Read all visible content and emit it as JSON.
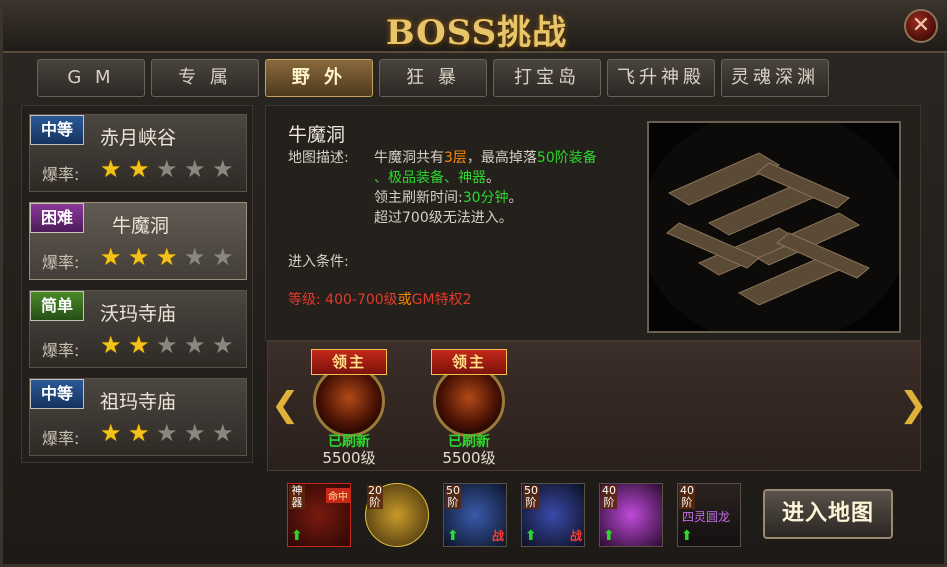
{
  "window": {
    "title": "BOSS挑战",
    "close_icon": "close-icon"
  },
  "tabs": [
    {
      "label": "G M",
      "active": false
    },
    {
      "label": "专 属",
      "active": false
    },
    {
      "label": "野 外",
      "active": true
    },
    {
      "label": "狂 暴",
      "active": false
    },
    {
      "label": "打宝岛",
      "active": false
    },
    {
      "label": "飞升神殿",
      "active": false
    },
    {
      "label": "灵魂深渊",
      "active": false
    }
  ],
  "maps": [
    {
      "difficulty": "中等",
      "name": "赤月峡谷",
      "rate_label": "爆率:",
      "stars": 2,
      "max_stars": 5,
      "selected": false
    },
    {
      "difficulty": "困难",
      "name": "牛魔洞",
      "rate_label": "爆率:",
      "stars": 3,
      "max_stars": 5,
      "selected": true
    },
    {
      "difficulty": "简单",
      "name": "沃玛寺庙",
      "rate_label": "爆率:",
      "stars": 2,
      "max_stars": 5,
      "selected": false
    },
    {
      "difficulty": "中等",
      "name": "祖玛寺庙",
      "rate_label": "爆率:",
      "stars": 2,
      "max_stars": 5,
      "selected": false
    }
  ],
  "detail": {
    "name": "牛魔洞",
    "desc_label": "地图描述:",
    "desc_line1_a": "牛魔洞共有",
    "desc_line1_b": "3层",
    "desc_line1_c": "，最高掉落",
    "desc_line1_d": "50阶装备",
    "desc_line2": "、极品装备、神器",
    "desc_line2_end": "。",
    "desc_line3_a": "领主刷新时间:",
    "desc_line3_b": "30分钟",
    "desc_line3_c": "。",
    "desc_line4": "超过700级无法进入。",
    "cond_label": "进入条件:",
    "cond_a": "等级: 400-700级",
    "cond_or": "或",
    "cond_b": "GM特权2"
  },
  "bosses": [
    {
      "banner": "领主",
      "status": "已刷新",
      "level": "5500级"
    },
    {
      "banner": "领主",
      "status": "已刷新",
      "level": "5500级"
    }
  ],
  "drops": [
    {
      "tag": "神器",
      "corner": "",
      "icon": "artifact-wings-icon"
    },
    {
      "tag": "20阶",
      "corner": "",
      "icon": "wings-item-icon"
    },
    {
      "tag": "50阶",
      "corner": "战",
      "icon": "weapon-item-icon"
    },
    {
      "tag": "50阶",
      "corner": "战",
      "icon": "armor-item-icon"
    },
    {
      "tag": "40阶",
      "corner": "",
      "icon": "orb-item-icon"
    },
    {
      "tag": "40阶",
      "corner": "",
      "icon": "scroll-item-icon"
    }
  ],
  "drop_caption": "四灵圆龙",
  "artifact_badge": "命中",
  "enter_button": "进入地图",
  "colors": {
    "accent_gold": "#e8c46a",
    "highlight_green": "#2cd82c",
    "highlight_orange": "#ff8a00",
    "highlight_red": "#e23a2a"
  }
}
